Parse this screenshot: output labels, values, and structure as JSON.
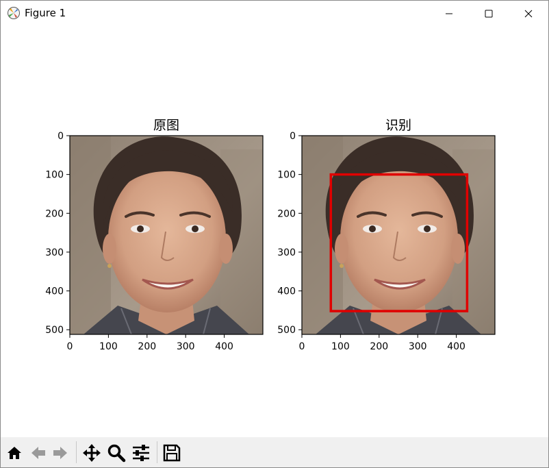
{
  "window": {
    "title": "Figure 1",
    "icons": {
      "app": "matplotlib-icon",
      "minimize": "minimize-icon",
      "maximize": "maximize-icon",
      "close": "close-icon"
    }
  },
  "chart_data": [
    {
      "type": "image",
      "title": "原图",
      "xlim": [
        0,
        500
      ],
      "ylim": [
        512,
        0
      ],
      "xticks": [
        "0",
        "100",
        "200",
        "300",
        "400"
      ],
      "yticks": [
        "0",
        "100",
        "200",
        "300",
        "400",
        "500"
      ]
    },
    {
      "type": "image",
      "title": "识别",
      "xlim": [
        0,
        500
      ],
      "ylim": [
        512,
        0
      ],
      "xticks": [
        "0",
        "100",
        "200",
        "300",
        "400"
      ],
      "yticks": [
        "0",
        "100",
        "200",
        "300",
        "400",
        "500"
      ],
      "detection_box": {
        "x0": 75,
        "y0": 100,
        "x1": 428,
        "y1": 452,
        "color": "#e00000"
      }
    }
  ],
  "toolbar": {
    "items": [
      "home-icon",
      "back-arrow-icon",
      "forward-arrow-icon",
      "pan-icon",
      "zoom-icon",
      "configure-subplots-icon",
      "save-icon"
    ]
  }
}
